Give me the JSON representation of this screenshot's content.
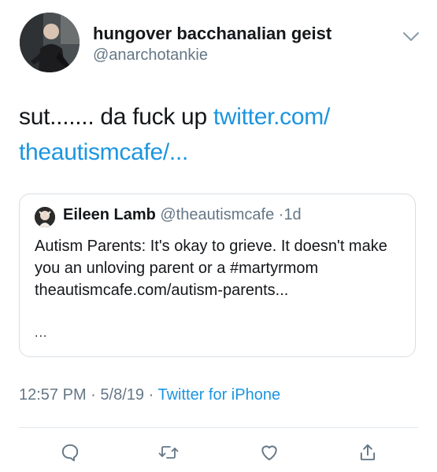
{
  "user": {
    "display_name": "hungover bacchanalian geist",
    "handle": "@anarchotankie"
  },
  "tweet": {
    "text_plain": "sut....... da fuck up ",
    "link_line1": "twitter.com/",
    "link_line2": "theautismcafe/..."
  },
  "quoted": {
    "name": "Eileen Lamb",
    "handle": "@theautismcafe",
    "separator": "·",
    "age": "1d",
    "body": "Autism Parents: It's okay to grieve. It doesn't make you an unloving parent or a #martyrmom theautismcafe.com/autism-parents...",
    "ellipsis": "..."
  },
  "meta": {
    "time": "12:57 PM",
    "sep1": "·",
    "date": "5/8/19",
    "sep2": "·",
    "source": "Twitter for iPhone"
  },
  "actions": [
    {
      "icon": "reply-icon"
    },
    {
      "icon": "retweet-icon"
    },
    {
      "icon": "like-icon"
    },
    {
      "icon": "share-icon"
    }
  ],
  "colors": {
    "link": "#1b95e0",
    "secondary_text": "#657786",
    "border": "#d9dee2"
  }
}
